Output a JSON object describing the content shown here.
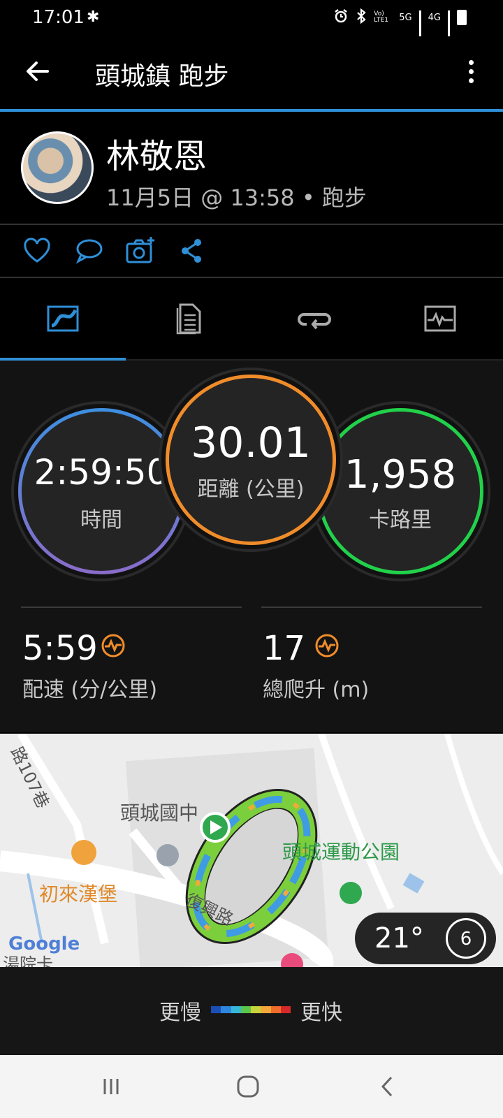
{
  "status_bar": {
    "time": "17:01",
    "lte_label": "Vo) LTE1",
    "net_5g": "5G",
    "net_4g": "4G"
  },
  "app_bar": {
    "title": "頭城鎮 跑步"
  },
  "profile": {
    "name": "林敬恩",
    "meta": "11月5日 @ 13:58 • 跑步"
  },
  "actions": [
    "heart-icon",
    "comment-icon",
    "add-photo-icon",
    "share-icon"
  ],
  "tabs": [
    "overview",
    "details",
    "laps",
    "charts"
  ],
  "stats": {
    "time_value": "2:59:50",
    "time_label": "時間",
    "distance_value": "30.01",
    "distance_label": "距離 (公里)",
    "calories_value": "1,958",
    "calories_label": "卡路里",
    "pace_value": "5:59",
    "pace_label": "配速 (分/公里)",
    "ascent_value": "17",
    "ascent_label": "總爬升 (m)"
  },
  "map": {
    "road_1": "路107巷",
    "school": "頭城國中",
    "park": "頭城運動公園",
    "restaurant": "初來漢堡",
    "road_2": "復興路",
    "partial_label": "湯院卡",
    "google": "Google",
    "temperature": "21°",
    "wind": "6"
  },
  "legend": {
    "slow": "更慢",
    "fast": "更快",
    "colors": [
      "#1b4fb8",
      "#2f86e0",
      "#36b7d8",
      "#5cc64a",
      "#c8d43c",
      "#f2a93a",
      "#ef6c2a",
      "#d62a2a"
    ]
  },
  "colors": {
    "accent": "#2f8fd7",
    "distance_ring": "#f08c2a",
    "calorie_ring": "#22d14a",
    "time_ring_top": "#3d8fe0",
    "time_ring_bottom": "#8a6cc9"
  }
}
